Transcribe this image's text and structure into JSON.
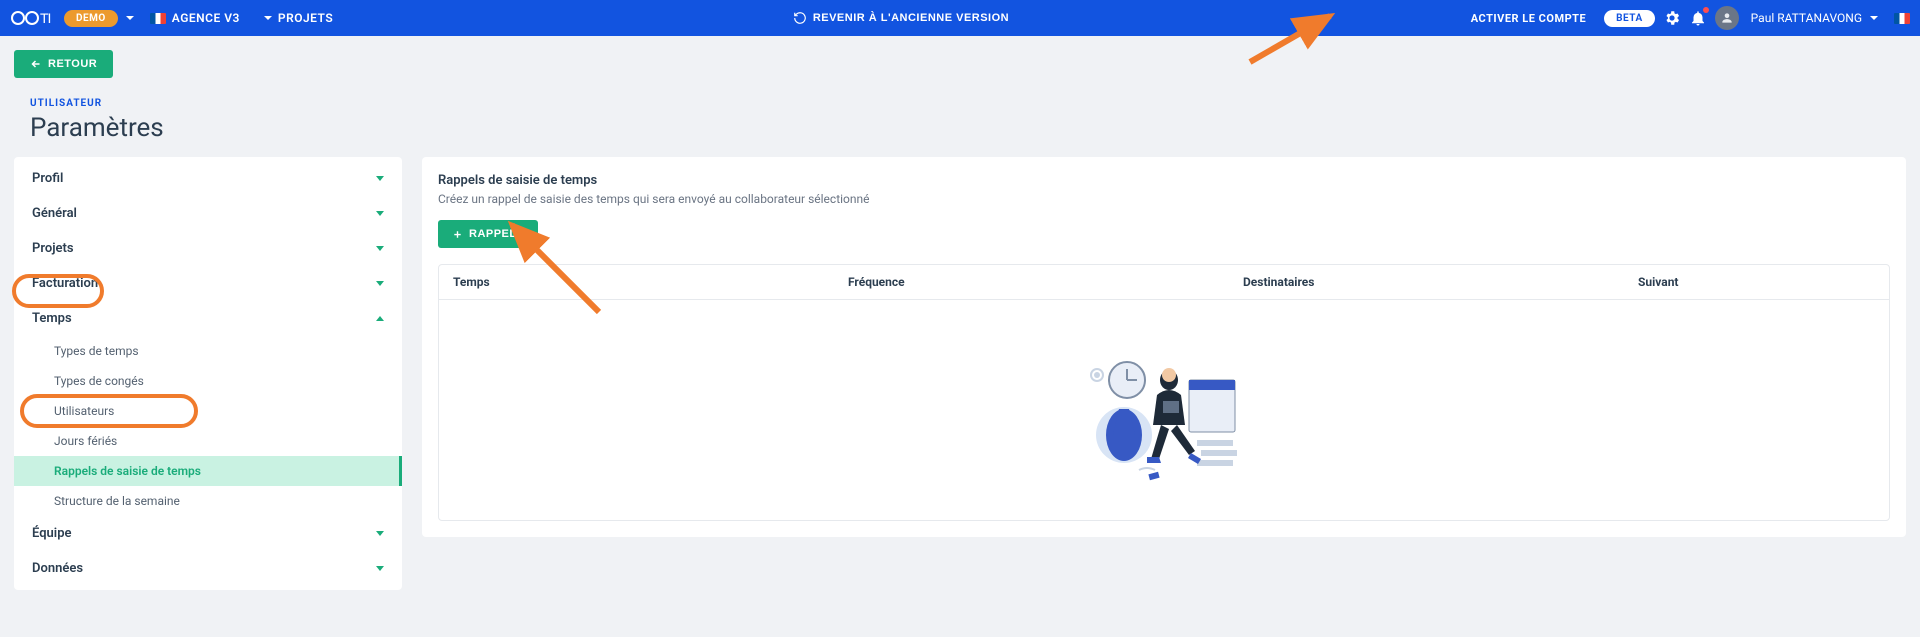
{
  "topbar": {
    "logo_text": "OOTI",
    "demo_badge": "DEMO",
    "agency_label": "AGENCE V3",
    "projects_label": "PROJETS",
    "revert_label": "REVENIR À L'ANCIENNE VERSION",
    "activate_label": "ACTIVER LE COMPTE",
    "beta_badge": "BETA",
    "username": "Paul RATTANAVONG"
  },
  "page": {
    "back_label": "RETOUR",
    "eyebrow": "UTILISATEUR",
    "title": "Paramètres"
  },
  "sidebar": {
    "sections": [
      {
        "label": "Profil",
        "expanded": false
      },
      {
        "label": "Général",
        "expanded": false
      },
      {
        "label": "Projets",
        "expanded": false
      },
      {
        "label": "Facturation",
        "expanded": false
      },
      {
        "label": "Temps",
        "expanded": true,
        "highlighted": true,
        "items": [
          {
            "label": "Types de temps",
            "active": false
          },
          {
            "label": "Types de congés",
            "active": false
          },
          {
            "label": "Utilisateurs",
            "active": false
          },
          {
            "label": "Jours fériés",
            "active": false
          },
          {
            "label": "Rappels de saisie de temps",
            "active": true,
            "highlighted": true
          },
          {
            "label": "Structure de la semaine",
            "active": false
          }
        ]
      },
      {
        "label": "Équipe",
        "expanded": false
      },
      {
        "label": "Données",
        "expanded": false
      }
    ]
  },
  "main": {
    "panel_title": "Rappels de saisie de temps",
    "panel_sub": "Créez un rappel de saisie des temps qui sera envoyé au collaborateur sélectionné",
    "add_button": "RAPPELS",
    "columns": [
      "Temps",
      "Fréquence",
      "Destinataires",
      "Suivant"
    ],
    "rows": []
  },
  "annotations": {
    "arrow_to_settings": true,
    "arrow_to_rappels_button": true
  }
}
